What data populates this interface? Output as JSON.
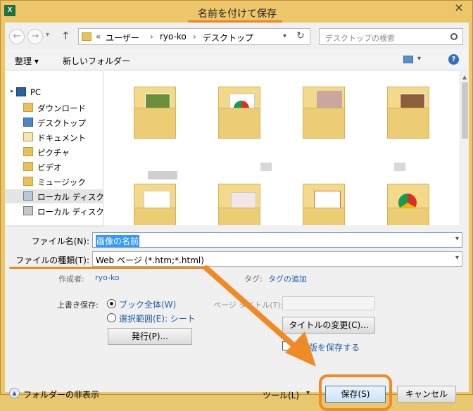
{
  "window": {
    "title": "名前を付けて保存",
    "app_icon": "X",
    "close_glyph": "×"
  },
  "address": {
    "back_glyph": "←",
    "forward_glyph": "→",
    "history_glyph": "▾",
    "up_glyph": "↑",
    "prefix": "«",
    "crumbs": [
      "ユーザー",
      "ryo-ko",
      "デスクトップ"
    ],
    "sep": "›",
    "dropdown_glyph": "▾",
    "refresh_glyph": "↻",
    "search_placeholder": "デスクトップの検索"
  },
  "toolbar": {
    "organize_label": "整理 ▾",
    "new_folder_label": "新しいフォルダー",
    "view_glyph": "▾",
    "help_glyph": "?"
  },
  "nav": {
    "items": [
      {
        "label": "PC",
        "icon": "pc-icon"
      },
      {
        "label": "ダウンロード",
        "icon": "downloads-icon"
      },
      {
        "label": "デスクトップ",
        "icon": "desktop-icon"
      },
      {
        "label": "ドキュメント",
        "icon": "documents-icon"
      },
      {
        "label": "ピクチャ",
        "icon": "pictures-icon"
      },
      {
        "label": "ビデオ",
        "icon": "videos-icon"
      },
      {
        "label": "ミュージック",
        "icon": "music-icon"
      },
      {
        "label": "ローカル ディスク (C",
        "icon": "disk-icon"
      },
      {
        "label": "ローカル ディスク (D",
        "icon": "disk-icon"
      }
    ]
  },
  "form": {
    "filename_label": "ファイル名(N):",
    "filename_value": "画像の名前",
    "filetype_label": "ファイルの種類(T):",
    "filetype_value": "Web ページ (*.htm;*.html)",
    "author_label": "作成者:",
    "author_value": "ryo-ko",
    "tag_label": "タグ:",
    "tag_value": "タグの追加",
    "overwrite_label": "上書き保存:",
    "radio_book_label": "ブック全体(W)",
    "radio_selection_label": "選択範囲(E): シート",
    "publish_button": "発行(P)...",
    "page_title_label": "ページ タイトル(T):",
    "change_title_button": "タイトルの変更(C)...",
    "save_thumbnail_label": "版を保存する"
  },
  "footer": {
    "hide_folders_label": "フォルダーの非表示",
    "tools_label": "ツール(L)",
    "save_button": "保存(S)",
    "cancel_button": "キャンセル"
  },
  "colors": {
    "title_accent": "#e8841c",
    "highlight_orange": "#f08a24",
    "link_blue": "#1e5ea8",
    "selection_blue": "#3399ff"
  }
}
